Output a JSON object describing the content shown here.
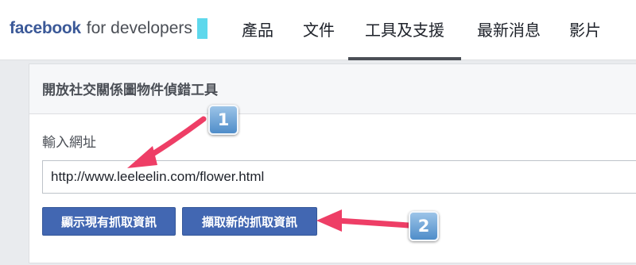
{
  "brand": {
    "logo_text": "facebook",
    "suffix_text": "for developers"
  },
  "nav": {
    "items": [
      {
        "label": "產品"
      },
      {
        "label": "文件"
      },
      {
        "label": "工具及支援",
        "active": true
      },
      {
        "label": "最新消息"
      },
      {
        "label": "影片"
      }
    ]
  },
  "panel": {
    "title": "開放社交關係圖物件偵錯工具",
    "url_label": "輸入網址",
    "url_value": "http://www.leeleelin.com/flower.html",
    "buttons": {
      "show_existing": "顯示現有抓取資訊",
      "fetch_new": "擷取新的抓取資訊"
    }
  },
  "annotations": {
    "callout_1": "1",
    "callout_2": "2",
    "arrow_color": "#ee3e66"
  },
  "colors": {
    "brand_blue": "#3b5998",
    "button_blue": "#4267b2",
    "page_bg": "#e9ebee"
  }
}
